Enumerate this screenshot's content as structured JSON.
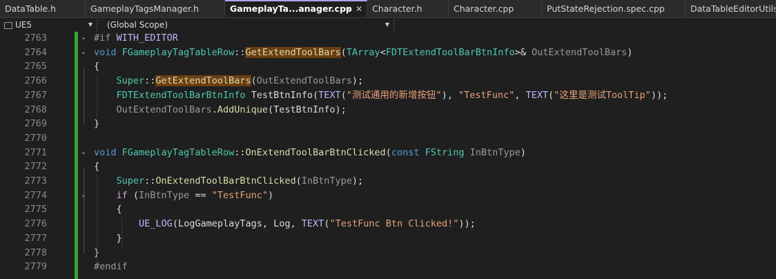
{
  "tabs": [
    {
      "label": "DataTable.h",
      "active": false
    },
    {
      "label": "GameplayTagsManager.h",
      "active": false
    },
    {
      "label": "GameplayTa...anager.cpp",
      "active": true
    },
    {
      "label": "Character.h",
      "active": false
    },
    {
      "label": "Character.cpp",
      "active": false
    },
    {
      "label": "PutStateRejection.spec.cpp",
      "active": false
    },
    {
      "label": "DataTableEditorUtils.c",
      "active": false
    }
  ],
  "tab_icons": {
    "pin": "⊸",
    "close": "✕"
  },
  "navbar": {
    "project": "UE5",
    "scope": "(Global Scope)"
  },
  "editor": {
    "line_numbers": [
      "2763",
      "2764",
      "2765",
      "2766",
      "2767",
      "2768",
      "2769",
      "2770",
      "2771",
      "2772",
      "2773",
      "2774",
      "2775",
      "2776",
      "2777",
      "2778",
      "2779"
    ],
    "lines": [
      [
        {
          "t": "#if ",
          "c": "pre"
        },
        {
          "t": "WITH_EDITOR",
          "c": "mac"
        }
      ],
      [
        {
          "t": "void ",
          "c": "kw"
        },
        {
          "t": "FGameplayTagTableRow",
          "c": "typ"
        },
        {
          "t": "::",
          "c": "var"
        },
        {
          "t": "GetExtendToolBars",
          "c": "hl"
        },
        {
          "t": "(",
          "c": "var"
        },
        {
          "t": "TArray",
          "c": "typ"
        },
        {
          "t": "<",
          "c": "var"
        },
        {
          "t": "FDTExtendToolBarBtnInfo",
          "c": "typ"
        },
        {
          "t": ">& ",
          "c": "var"
        },
        {
          "t": "OutExtendToolBars",
          "c": "par"
        },
        {
          "t": ")",
          "c": "var"
        }
      ],
      [
        {
          "t": "{",
          "c": "var"
        }
      ],
      [
        {
          "t": "    ",
          "c": "var"
        },
        {
          "t": "Super",
          "c": "typ"
        },
        {
          "t": "::",
          "c": "var"
        },
        {
          "t": "GetExtendToolBars",
          "c": "hl"
        },
        {
          "t": "(",
          "c": "var"
        },
        {
          "t": "OutExtendToolBars",
          "c": "par"
        },
        {
          "t": ");",
          "c": "var"
        }
      ],
      [
        {
          "t": "    ",
          "c": "var"
        },
        {
          "t": "FDTExtendToolBarBtnInfo ",
          "c": "typ"
        },
        {
          "t": "TestBtnInfo",
          "c": "var"
        },
        {
          "t": "(",
          "c": "var"
        },
        {
          "t": "TEXT",
          "c": "mac"
        },
        {
          "t": "(",
          "c": "var"
        },
        {
          "t": "\"测试通用的新增按钮\"",
          "c": "str"
        },
        {
          "t": "), ",
          "c": "var"
        },
        {
          "t": "\"TestFunc\"",
          "c": "str"
        },
        {
          "t": ", ",
          "c": "var"
        },
        {
          "t": "TEXT",
          "c": "mac"
        },
        {
          "t": "(",
          "c": "var"
        },
        {
          "t": "\"这里是测试ToolTip\"",
          "c": "str"
        },
        {
          "t": "));",
          "c": "var"
        }
      ],
      [
        {
          "t": "    ",
          "c": "var"
        },
        {
          "t": "OutExtendToolBars",
          "c": "par"
        },
        {
          "t": ".",
          "c": "var"
        },
        {
          "t": "AddUnique",
          "c": "fn"
        },
        {
          "t": "(",
          "c": "var"
        },
        {
          "t": "TestBtnInfo",
          "c": "var"
        },
        {
          "t": ");",
          "c": "var"
        }
      ],
      [
        {
          "t": "}",
          "c": "var"
        }
      ],
      [],
      [
        {
          "t": "void ",
          "c": "kw"
        },
        {
          "t": "FGameplayTagTableRow",
          "c": "typ"
        },
        {
          "t": "::",
          "c": "var"
        },
        {
          "t": "OnExtendToolBarBtnClicked",
          "c": "fn"
        },
        {
          "t": "(",
          "c": "var"
        },
        {
          "t": "const ",
          "c": "kw"
        },
        {
          "t": "FString ",
          "c": "typ"
        },
        {
          "t": "InBtnType",
          "c": "par"
        },
        {
          "t": ")",
          "c": "var"
        }
      ],
      [
        {
          "t": "{",
          "c": "var"
        }
      ],
      [
        {
          "t": "    ",
          "c": "var"
        },
        {
          "t": "Super",
          "c": "typ"
        },
        {
          "t": "::",
          "c": "var"
        },
        {
          "t": "OnExtendToolBarBtnClicked",
          "c": "fn"
        },
        {
          "t": "(",
          "c": "var"
        },
        {
          "t": "InBtnType",
          "c": "par"
        },
        {
          "t": ");",
          "c": "var"
        }
      ],
      [
        {
          "t": "    ",
          "c": "var"
        },
        {
          "t": "if ",
          "c": "ctl"
        },
        {
          "t": "(",
          "c": "var"
        },
        {
          "t": "InBtnType",
          "c": "par"
        },
        {
          "t": " == ",
          "c": "var"
        },
        {
          "t": "\"TestFunc\"",
          "c": "str"
        },
        {
          "t": ")",
          "c": "var"
        }
      ],
      [
        {
          "t": "    {",
          "c": "var"
        }
      ],
      [
        {
          "t": "        ",
          "c": "var"
        },
        {
          "t": "UE_LOG",
          "c": "mac"
        },
        {
          "t": "(",
          "c": "var"
        },
        {
          "t": "LogGameplayTags",
          "c": "var"
        },
        {
          "t": ", Log, ",
          "c": "var"
        },
        {
          "t": "TEXT",
          "c": "mac"
        },
        {
          "t": "(",
          "c": "var"
        },
        {
          "t": "\"TestFunc Btn Clicked!\"",
          "c": "str"
        },
        {
          "t": "));",
          "c": "var"
        }
      ],
      [
        {
          "t": "    }",
          "c": "var"
        }
      ],
      [
        {
          "t": "}",
          "c": "var"
        }
      ],
      [
        {
          "t": "#endif",
          "c": "pre"
        }
      ]
    ],
    "fold_markers": {
      "0": "⌄",
      "1": "⌄",
      "8": "⌄",
      "11": "⌄"
    },
    "colors": {
      "keyword": "#569cd6",
      "type": "#4ec9b0",
      "function": "#dcdcaa",
      "string": "#e9a27a",
      "macro": "#beb7ff",
      "change_bar": "#3aa33a",
      "highlight": "#6b3e12"
    }
  }
}
